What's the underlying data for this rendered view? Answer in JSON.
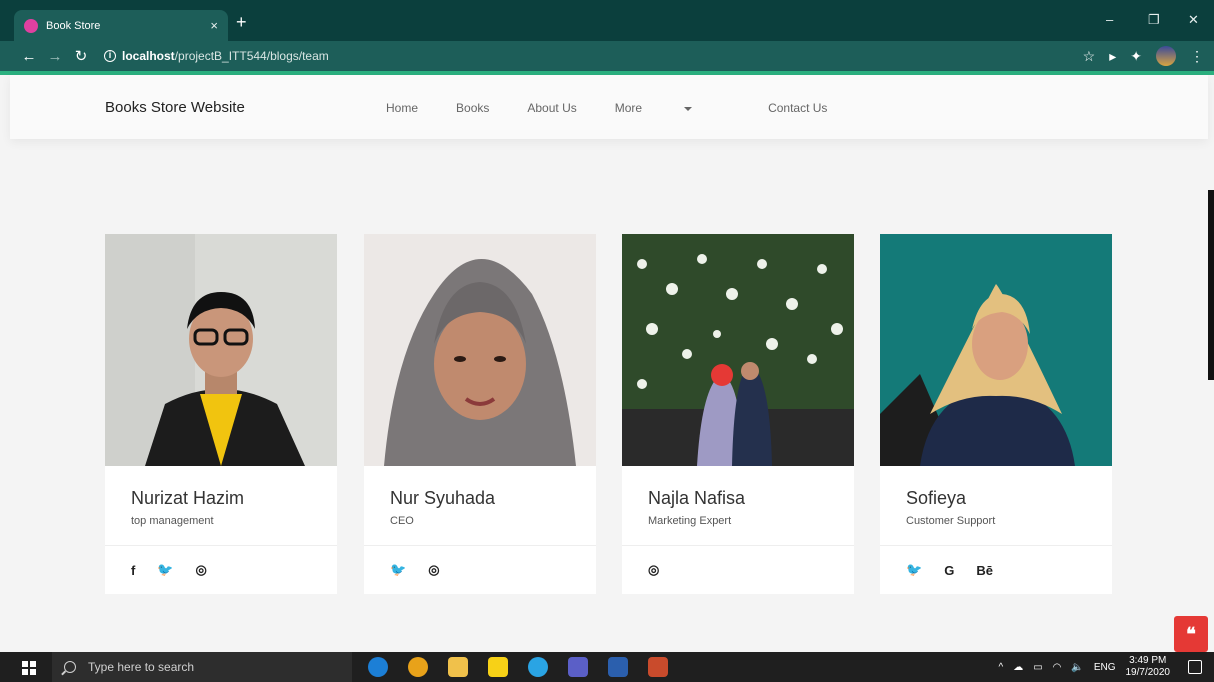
{
  "browser": {
    "tab_title": "Book Store",
    "tab_close": "×",
    "new_tab": "+",
    "url_host": "localhost",
    "url_path": "/projectB_ITT544/blogs/team",
    "win_minimize": "–",
    "win_restore": "❐",
    "win_close": "✕"
  },
  "site": {
    "brand": "Books Store Website",
    "menu": [
      "Home",
      "Books",
      "About Us",
      "More",
      "Contact Us"
    ]
  },
  "team": [
    {
      "name": "Nurizat Hazim",
      "role": "top management",
      "social": [
        "facebook",
        "twitter",
        "instagram"
      ]
    },
    {
      "name": "Nur Syuhada",
      "role": "CEO",
      "social": [
        "twitter",
        "instagram"
      ]
    },
    {
      "name": "Najla Nafisa",
      "role": "Marketing Expert",
      "social": [
        "instagram"
      ]
    },
    {
      "name": "Sofieya",
      "role": "Customer Support",
      "social": [
        "twitter",
        "google",
        "behance"
      ]
    }
  ],
  "taskbar": {
    "search_placeholder": "Type here to search",
    "language": "ENG",
    "time": "3:49 PM",
    "date": "19/7/2020"
  }
}
